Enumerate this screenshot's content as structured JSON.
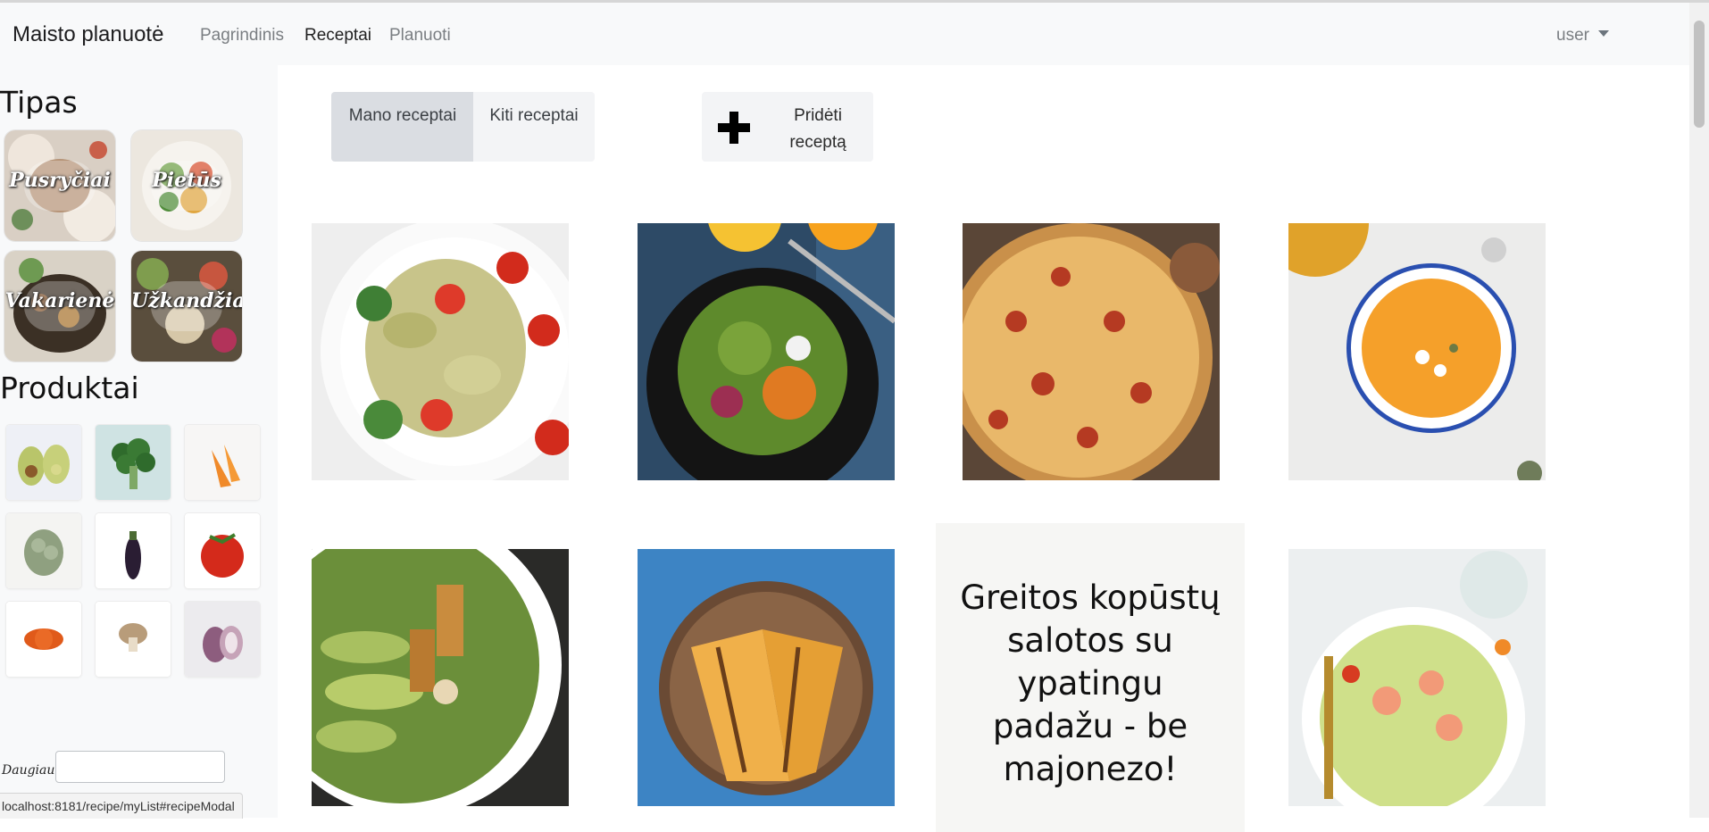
{
  "navbar": {
    "brand": "Maisto planuotė",
    "links": [
      "Pagrindinis",
      "Receptai",
      "Planuoti"
    ],
    "active_link": "Receptai",
    "user": "user"
  },
  "sidebar": {
    "type_title": "Tipas",
    "types": [
      "Pusryčiai",
      "Pietūs",
      "Vakarienė",
      "Užkandžiai"
    ],
    "products_title": "Produktai",
    "products": [
      "avocado",
      "broccoli",
      "carrot",
      "cauliflower",
      "eggplant",
      "tomato",
      "pumpkin",
      "mushroom",
      "onion"
    ],
    "more_label": "Daugiau:",
    "more_value": ""
  },
  "toolbar": {
    "my_recipes": "Mano receptai",
    "other_recipes": "Kiti receptai",
    "add_recipe": "Pridėti receptą"
  },
  "recipes": [
    {
      "image": "pasta-salad"
    },
    {
      "image": "green-salad"
    },
    {
      "image": "pizza"
    },
    {
      "image": "pumpkin-soup"
    },
    {
      "image": "chicken-avocado-salad"
    },
    {
      "image": "grilled-sandwich"
    },
    {
      "title": "Greitos kopūstų salotos su ypatingu padažu - be majonezo!"
    },
    {
      "image": "shrimp-salad"
    }
  ],
  "status_url": "localhost:8181/recipe/myList#recipeModal",
  "colors": {
    "navbar_bg": "#f8f9fa",
    "selected_tab_bg": "#dadde2",
    "tab_bg": "#f3f4f6"
  }
}
